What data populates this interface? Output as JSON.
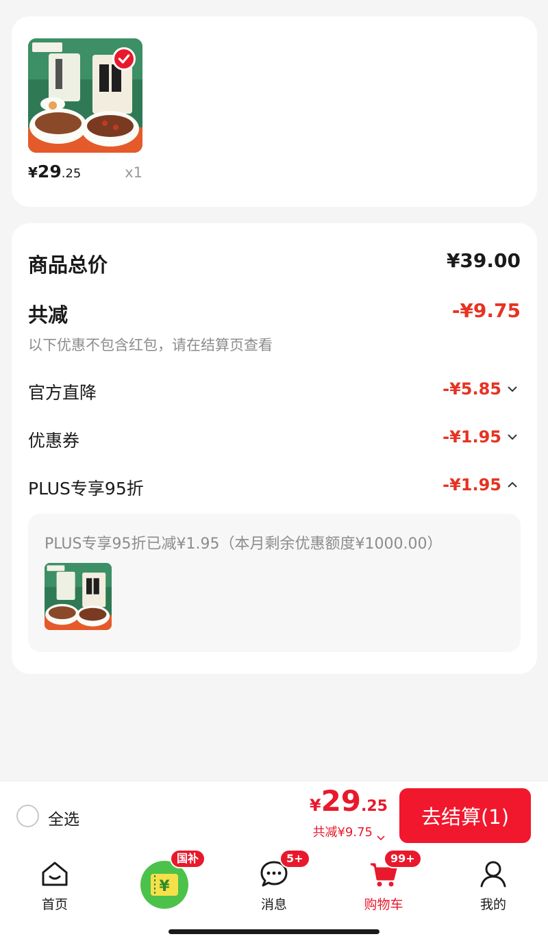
{
  "product": {
    "thumbnail_icon": "lotus-root-powder-product-image",
    "selected_icon": "check-icon",
    "price_symbol": "¥",
    "price_int": "29",
    "price_dec": ".25",
    "quantity": "x1"
  },
  "summary": {
    "total_label": "商品总价",
    "total_value": "¥39.00",
    "reduce_label": "共减",
    "reduce_value": "-¥9.75",
    "hint": "以下优惠不包含红包，请在结算页查看",
    "discounts": [
      {
        "label": "官方直降",
        "value": "-¥5.85",
        "expanded": false
      },
      {
        "label": "优惠券",
        "value": "-¥1.95",
        "expanded": false
      },
      {
        "label": "PLUS专享95折",
        "value": "-¥1.95",
        "expanded": true
      }
    ],
    "plus_detail": "PLUS专享95折已减¥1.95（本月剩余优惠额度¥1000.00）"
  },
  "checkout": {
    "select_all_label": "全选",
    "total_symbol": "¥",
    "total_int": "29",
    "total_dec": ".25",
    "reduce_text": "共减¥9.75",
    "button_label": "去结算(1)"
  },
  "tabbar": {
    "tabs": [
      {
        "label": "首页",
        "icon": "home-icon",
        "active": false
      },
      {
        "label": "",
        "icon": "subsidy-yen-icon",
        "badge": "国补",
        "active": false
      },
      {
        "label": "消息",
        "icon": "message-icon",
        "badge": "5+",
        "active": false
      },
      {
        "label": "购物车",
        "icon": "cart-icon",
        "badge": "99+",
        "active": true
      },
      {
        "label": "我的",
        "icon": "profile-icon",
        "active": false
      }
    ]
  },
  "colors": {
    "accent": "#e8192c",
    "discount": "#e63322",
    "background": "#f5f5f5"
  }
}
